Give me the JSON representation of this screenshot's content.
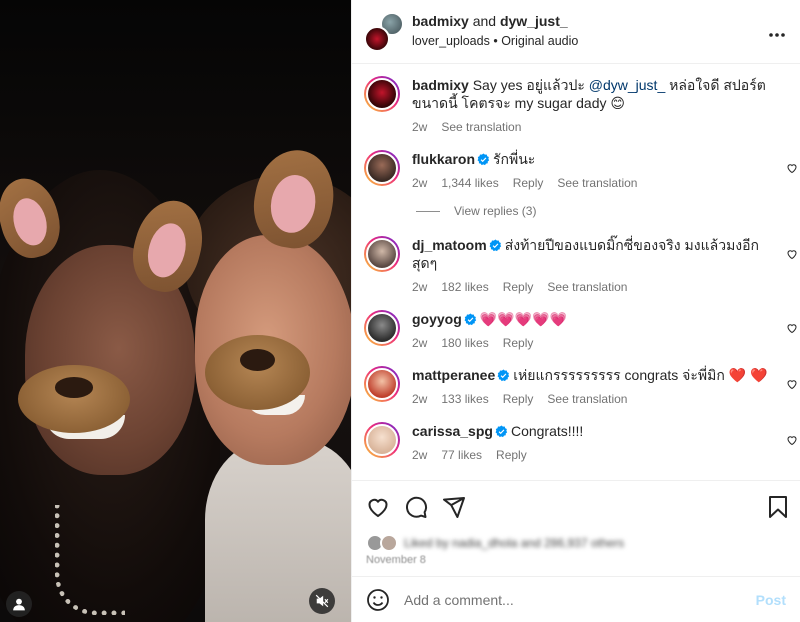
{
  "header": {
    "user1": "badmixy",
    "and": "and",
    "user2": "dyw_just_",
    "sub_user": "lover_uploads",
    "sub_sep": "•",
    "audio": "Original audio",
    "more_icon": "more-horizontal-icon"
  },
  "caption": {
    "username": "badmixy",
    "text_before": "Say yes อยู่แล้วปะ",
    "mention": "@dyw_just_",
    "text_after": "หล่อใจดี สปอร์ต ขนาดนี้ โคตรจะ my sugar dady 😊",
    "time": "2w",
    "translate": "See translation"
  },
  "comments": [
    {
      "username": "flukkaron",
      "verified": true,
      "text": "รักพี่นะ",
      "time": "2w",
      "likes": "1,344 likes",
      "reply": "Reply",
      "translate": "See translation",
      "avatar_color": "#3a2a24"
    },
    {
      "username": "dj_matoom",
      "verified": true,
      "text": "ส่งท้ายปีของแบดมิ๊กซี่ของจริง มงแล้วมงอีกสุดๆ",
      "time": "2w",
      "likes": "182 likes",
      "reply": "Reply",
      "translate": "See translation",
      "avatar_color": "#5b4a44"
    },
    {
      "username": "goyyog",
      "verified": true,
      "text": "💗💗💗💗💗",
      "time": "2w",
      "likes": "180 likes",
      "reply": "Reply",
      "avatar_color": "#2d2d2d"
    },
    {
      "username": "mattperanee",
      "verified": true,
      "text": "เห่ยแกรรรรรรรรร congrats จ่ะพี่มิก ❤️ ❤️",
      "time": "2w",
      "likes": "133 likes",
      "reply": "Reply",
      "translate": "See translation",
      "avatar_color": "#c0412e"
    },
    {
      "username": "carissa_spg",
      "verified": true,
      "text": "Congrats!!!!",
      "time": "2w",
      "likes": "77 likes",
      "reply": "Reply",
      "avatar_color": "#d9b49a"
    }
  ],
  "view_replies": "View replies (3)",
  "actions": {
    "like_icon": "heart-icon",
    "comment_icon": "comment-icon",
    "share_icon": "send-icon",
    "save_icon": "bookmark-icon"
  },
  "likes_line": "Liked by nadia_dhola and 286,937 others",
  "date": "November 8",
  "add_comment": {
    "placeholder": "Add a comment...",
    "post": "Post"
  },
  "colors": {
    "verified": "#0095f6",
    "link": "#00376b",
    "muted": "#737373",
    "post_disabled": "#b2dffc"
  }
}
